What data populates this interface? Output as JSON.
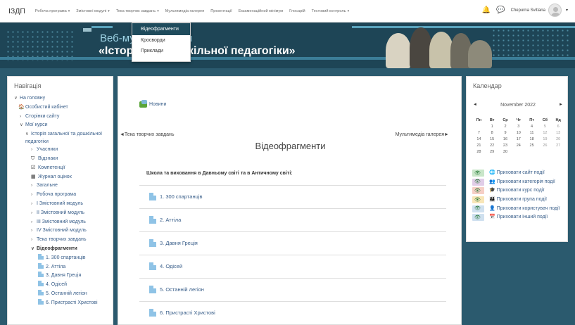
{
  "brand": "ІЗДП",
  "topmenu": [
    {
      "label": "Робоча програма",
      "caret": "▾",
      "active": false
    },
    {
      "label": "Змістовні модулі",
      "caret": "▾",
      "active": false
    },
    {
      "label": "Тека творчих завдань",
      "caret": "▾",
      "active": true
    },
    {
      "label": "Мультимедіа галерея",
      "caret": "",
      "active": false
    },
    {
      "label": "Презентації",
      "caret": "",
      "active": false
    },
    {
      "label": "Екзаменаційний мінімум",
      "caret": "",
      "active": false
    },
    {
      "label": "Глосарій",
      "caret": "",
      "active": false
    },
    {
      "label": "Тестовий контроль",
      "caret": "▾",
      "active": false
    }
  ],
  "user": {
    "name": "Chepurna Svitlana",
    "bell": "🔔",
    "chat": "💬",
    "caret": "▾"
  },
  "dropdown": [
    "Відеофрагменти",
    "Кросворди",
    "Приклади"
  ],
  "banner": {
    "line1": "Веб-му                    циклопедія",
    "line2": "«Істор                    ої та дошкільної педагогіки»"
  },
  "nav": {
    "title": "Навігація",
    "items": [
      {
        "label": "На головну",
        "chev": "∨",
        "icon": "",
        "indent": 0,
        "bold": false,
        "file": false
      },
      {
        "label": "Особистий кабінет",
        "chev": "",
        "icon": "🏠",
        "indent": 6,
        "bold": false,
        "file": false
      },
      {
        "label": "Сторінки сайту",
        "chev": "›",
        "icon": "",
        "indent": 8,
        "bold": false,
        "file": false
      },
      {
        "label": "Мої курси",
        "chev": "∨",
        "icon": "",
        "indent": 8,
        "bold": false,
        "file": false
      },
      {
        "label": "Історія загальної та дошкільної педагогіки",
        "chev": "∨",
        "icon": "",
        "indent": 16,
        "bold": false,
        "file": false,
        "wrap": true
      },
      {
        "label": "Учасники",
        "chev": "›",
        "icon": "",
        "indent": 24,
        "bold": false,
        "file": false
      },
      {
        "label": "Відзнаки",
        "chev": "",
        "icon": "⛉",
        "indent": 24,
        "bold": false,
        "file": false
      },
      {
        "label": "Компетенції",
        "chev": "",
        "icon": "☑",
        "indent": 24,
        "bold": false,
        "file": false
      },
      {
        "label": "Журнал оцінок",
        "chev": "",
        "icon": "▦",
        "indent": 24,
        "bold": false,
        "file": false
      },
      {
        "label": "Загальне",
        "chev": "›",
        "icon": "",
        "indent": 24,
        "bold": false,
        "file": false
      },
      {
        "label": "Робоча програма",
        "chev": "›",
        "icon": "",
        "indent": 24,
        "bold": false,
        "file": false
      },
      {
        "label": "І Змістовний модуль",
        "chev": "›",
        "icon": "",
        "indent": 24,
        "bold": false,
        "file": false
      },
      {
        "label": "ІІ Змістовний модуль",
        "chev": "›",
        "icon": "",
        "indent": 24,
        "bold": false,
        "file": false
      },
      {
        "label": "ІІІ Змістовний модуль",
        "chev": "›",
        "icon": "",
        "indent": 24,
        "bold": false,
        "file": false
      },
      {
        "label": "IV Змістовний модуль",
        "chev": "›",
        "icon": "",
        "indent": 24,
        "bold": false,
        "file": false
      },
      {
        "label": "Тека творчих завдань",
        "chev": "›",
        "icon": "",
        "indent": 24,
        "bold": false,
        "file": false
      },
      {
        "label": "Відеофрагменти",
        "chev": "∨",
        "icon": "",
        "indent": 24,
        "bold": true,
        "file": false
      },
      {
        "label": "1. 300 спартанців",
        "chev": "",
        "icon": "",
        "indent": 34,
        "bold": false,
        "file": true
      },
      {
        "label": "2. Аттіла",
        "chev": "",
        "icon": "",
        "indent": 34,
        "bold": false,
        "file": true
      },
      {
        "label": "3. Давня Греція",
        "chev": "",
        "icon": "",
        "indent": 34,
        "bold": false,
        "file": true
      },
      {
        "label": "4. Одісей",
        "chev": "",
        "icon": "",
        "indent": 34,
        "bold": false,
        "file": true
      },
      {
        "label": "5. Останній легіон",
        "chev": "",
        "icon": "",
        "indent": 34,
        "bold": false,
        "file": true
      },
      {
        "label": "6. Пристрасті Христові",
        "chev": "",
        "icon": "",
        "indent": 34,
        "bold": false,
        "file": true
      }
    ]
  },
  "main": {
    "forum": "Новини",
    "prev": "◄Тека творчих завдань",
    "next": "Мультимедіа галерея►",
    "title": "Відеофрагменти",
    "section": "Школа та виховання в Давньому світі та в Античному світі:",
    "activities": [
      "1. 300 спартанців",
      "2. Аттіла",
      "3. Давня Греція",
      "4. Одісей",
      "5. Останній легіон",
      "6. Пристрасті Христові"
    ]
  },
  "calendar": {
    "title": "Календар",
    "month": "November 2022",
    "prev": "◄",
    "next": "►",
    "days": [
      "Пн",
      "Вт",
      "Ср",
      "Чт",
      "Пт",
      "Сб",
      "Нд"
    ],
    "weeks": [
      [
        "",
        "1",
        "2",
        "3",
        "4",
        "5",
        "6"
      ],
      [
        "7",
        "8",
        "9",
        "10",
        "11",
        "12",
        "13"
      ],
      [
        "14",
        "15",
        "16",
        "17",
        "18",
        "19",
        "20"
      ],
      [
        "21",
        "22",
        "23",
        "24",
        "25",
        "26",
        "27"
      ],
      [
        "28",
        "29",
        "30",
        "",
        "",
        "",
        ""
      ]
    ],
    "events": [
      {
        "label": "Приховати сайт події",
        "icon": "🌐",
        "color": "#c9e6c9"
      },
      {
        "label": "Приховати категорія події",
        "icon": "👥",
        "color": "#e1cde8"
      },
      {
        "label": "Приховати курс події",
        "icon": "🎓",
        "color": "#f6cfc6"
      },
      {
        "label": "Приховати група події",
        "icon": "👪",
        "color": "#f8e6b8"
      },
      {
        "label": "Приховати користувач події",
        "icon": "👤",
        "color": "#cfe0ef"
      },
      {
        "label": "Приховати інший події",
        "icon": "📅",
        "color": "#cfe0ef"
      }
    ],
    "eye": "👁"
  }
}
